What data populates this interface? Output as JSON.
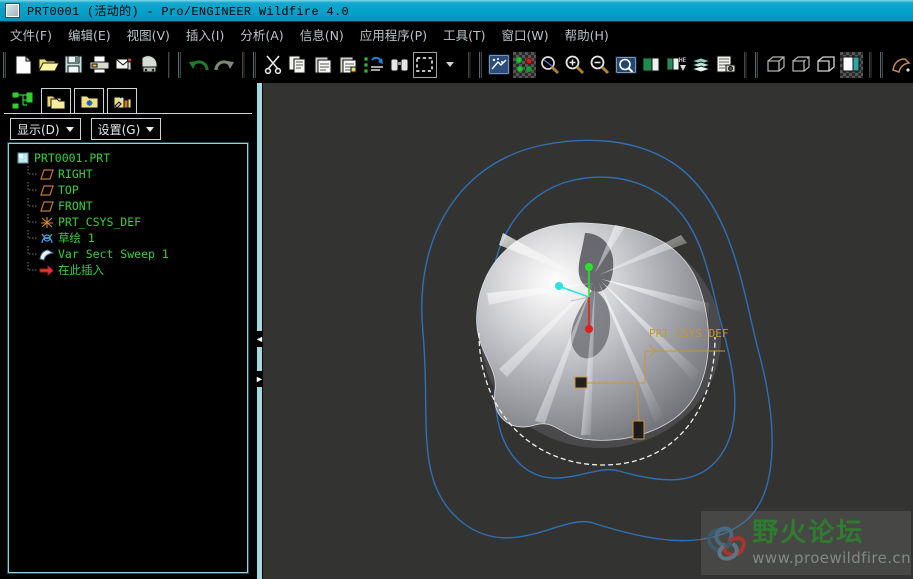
{
  "window": {
    "title": "PRT0001  (活动的) - Pro/ENGINEER Wildfire 4.0",
    "icon": "document-icon"
  },
  "menubar": {
    "items": [
      {
        "label": "文件(F)",
        "name": "menu-file"
      },
      {
        "label": "编辑(E)",
        "name": "menu-edit"
      },
      {
        "label": "视图(V)",
        "name": "menu-view"
      },
      {
        "label": "插入(I)",
        "name": "menu-insert"
      },
      {
        "label": "分析(A)",
        "name": "menu-analysis"
      },
      {
        "label": "信息(N)",
        "name": "menu-info"
      },
      {
        "label": "应用程序(P)",
        "name": "menu-applications"
      },
      {
        "label": "工具(T)",
        "name": "menu-tools"
      },
      {
        "label": "窗口(W)",
        "name": "menu-window"
      },
      {
        "label": "帮助(H)",
        "name": "menu-help"
      }
    ]
  },
  "toolbar": {
    "groups": [
      {
        "name": "file-group",
        "buttons": [
          {
            "icon": "new-file-icon",
            "label": "新建"
          },
          {
            "icon": "open-folder-icon",
            "label": "打开"
          },
          {
            "icon": "save-icon",
            "label": "保存"
          },
          {
            "icon": "print-icon",
            "label": "打印"
          },
          {
            "icon": "mail-icon",
            "label": "发送"
          },
          {
            "icon": "model-player-icon",
            "label": "模型播放器"
          }
        ]
      },
      {
        "name": "undo-group",
        "buttons": [
          {
            "icon": "undo-icon",
            "label": "撤消"
          },
          {
            "icon": "redo-icon",
            "label": "重做"
          }
        ]
      },
      {
        "name": "clipboard-group",
        "buttons": [
          {
            "icon": "cut-icon",
            "label": "剪切"
          },
          {
            "icon": "copy-icon",
            "label": "复制"
          },
          {
            "icon": "paste-icon",
            "label": "粘贴"
          },
          {
            "icon": "paste-special-icon",
            "label": "选择性粘贴"
          },
          {
            "icon": "regenerate-icon",
            "label": "重新生成"
          },
          {
            "icon": "find-icon",
            "label": "查找"
          },
          {
            "icon": "select-box-icon",
            "label": "选取",
            "state": "framed"
          },
          {
            "icon": "chevron-down-icon",
            "label": "选取过滤"
          }
        ]
      },
      {
        "name": "display-group",
        "buttons": [
          {
            "icon": "repaint-icon",
            "label": "重画"
          },
          {
            "icon": "datum-display-icon",
            "label": "基准显示",
            "state": "checked"
          },
          {
            "icon": "spin-center-icon",
            "label": "旋转中心"
          },
          {
            "icon": "zoom-in-icon",
            "label": "放大"
          },
          {
            "icon": "zoom-out-icon",
            "label": "缩小"
          },
          {
            "icon": "refit-icon",
            "label": "重新调整"
          },
          {
            "icon": "saved-view-icon",
            "label": "已保存视图"
          },
          {
            "icon": "view-manager-icon",
            "label": "视图管理器"
          },
          {
            "icon": "layers-icon",
            "label": "层"
          },
          {
            "icon": "appearance-icon",
            "label": "外观"
          }
        ]
      },
      {
        "name": "style-group",
        "buttons": [
          {
            "icon": "wireframe-icon",
            "label": "线框"
          },
          {
            "icon": "hidden-line-icon",
            "label": "隐藏线"
          },
          {
            "icon": "no-hidden-icon",
            "label": "无隐藏线"
          },
          {
            "icon": "shading-icon",
            "label": "着色",
            "state": "checked"
          }
        ]
      },
      {
        "name": "feature-group",
        "buttons": [
          {
            "icon": "sweep-feature-icon",
            "label": "扫描"
          }
        ]
      }
    ]
  },
  "navigator": {
    "tabs": [
      {
        "name": "tab-model-tree",
        "icon": "model-tree-icon",
        "label": "模型树",
        "active": true
      },
      {
        "name": "tab-folder-browser",
        "icon": "folder-browser-icon",
        "label": "文件夹浏览器",
        "active": false
      },
      {
        "name": "tab-favorites",
        "icon": "favorites-folder-icon",
        "label": "收藏夹",
        "active": false
      },
      {
        "name": "tab-connections",
        "icon": "connections-icon",
        "label": "连接",
        "active": false
      }
    ],
    "buttons": [
      {
        "name": "display-menu-button",
        "label": "显示(D)"
      },
      {
        "name": "settings-menu-button",
        "label": "设置(G)"
      }
    ],
    "tree": [
      {
        "label": "PRT0001.PRT",
        "icon": "part-icon",
        "depth": 0,
        "color": "green"
      },
      {
        "label": "RIGHT",
        "icon": "datum-plane-icon",
        "depth": 1,
        "color": "green"
      },
      {
        "label": "TOP",
        "icon": "datum-plane-icon",
        "depth": 1,
        "color": "green"
      },
      {
        "label": "FRONT",
        "icon": "datum-plane-icon",
        "depth": 1,
        "color": "green"
      },
      {
        "label": "PRT_CSYS_DEF",
        "icon": "coord-system-icon",
        "depth": 1,
        "color": "green"
      },
      {
        "label": "草绘 1",
        "icon": "sketch-icon",
        "depth": 1,
        "color": "green"
      },
      {
        "label": "Var Sect Sweep 1",
        "icon": "sweep-icon",
        "depth": 1,
        "color": "green"
      },
      {
        "label": "在此插入",
        "icon": "insert-here-arrow-icon",
        "depth": 1,
        "color": "green"
      }
    ]
  },
  "splitter": {
    "collapse_left_label": "◄",
    "collapse_right_label": "►"
  },
  "viewport": {
    "background_color": "#333331",
    "curve_color": "#2f6fb5",
    "csys_label": "PRT_CSYS_DEF",
    "axis_colors": {
      "x": "#2ee0e0",
      "y": "#2ee02e",
      "z": "#e02020"
    },
    "watermark": {
      "title": "野火论坛",
      "url": "www.proewildfire.cn",
      "logo": "butterfly-logo-icon",
      "title_color": "#2e7d2e",
      "url_color": "#7f8a82"
    }
  }
}
